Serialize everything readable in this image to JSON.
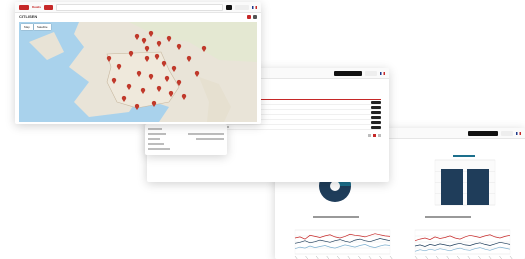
{
  "app": {
    "logo_text": "Dualis",
    "map_title": "CITLISEN",
    "map_tabs": [
      "Map",
      "Satellite"
    ]
  },
  "colors": {
    "accent": "#c62828",
    "dark": "#1f3d5a",
    "teal": "#1c6f8c"
  },
  "icons": [
    "logo-icon",
    "search-icon",
    "flag-icon",
    "map-marker-icon",
    "close-icon"
  ],
  "chart_data": [
    {
      "type": "bar",
      "categories": [
        "",
        ""
      ],
      "values": [
        80,
        80
      ],
      "title": "",
      "ylim": [
        0,
        100
      ]
    },
    {
      "type": "line",
      "x": [
        1,
        2,
        3,
        4,
        5,
        6,
        7,
        8,
        9,
        10,
        11,
        12,
        13,
        14,
        15,
        16,
        17,
        18,
        19,
        20
      ],
      "series": [
        {
          "values": [
            50,
            52,
            48,
            55,
            53,
            51,
            54,
            56,
            52,
            50,
            53,
            57,
            55,
            54,
            52,
            55,
            58,
            56,
            54,
            53
          ]
        },
        {
          "values": [
            40,
            42,
            45,
            41,
            43,
            46,
            44,
            42,
            45,
            47,
            44,
            42,
            46,
            48,
            45,
            43,
            46,
            49,
            47,
            45
          ]
        },
        {
          "values": [
            30,
            33,
            31,
            35,
            32,
            34,
            36,
            33,
            31,
            34,
            37,
            35,
            33,
            36,
            38,
            34,
            32,
            35,
            37,
            36
          ]
        }
      ],
      "title": ""
    },
    {
      "type": "line",
      "x": [
        1,
        2,
        3,
        4,
        5,
        6,
        7,
        8,
        9,
        10,
        11,
        12,
        13,
        14,
        15,
        16,
        17,
        18,
        19,
        20
      ],
      "series": [
        {
          "values": [
            45,
            48,
            50,
            47,
            52,
            49,
            51,
            54,
            50,
            48,
            52,
            55,
            53,
            51,
            54,
            56,
            52,
            50,
            53,
            55
          ]
        },
        {
          "values": [
            35,
            37,
            34,
            38,
            36,
            39,
            37,
            35,
            38,
            40,
            37,
            36,
            39,
            41,
            38,
            36,
            39,
            42,
            40,
            38
          ]
        },
        {
          "values": [
            25,
            28,
            26,
            29,
            27,
            30,
            28,
            26,
            29,
            31,
            28,
            27,
            30,
            32,
            29,
            27,
            30,
            33,
            31,
            29
          ]
        }
      ],
      "title": ""
    }
  ]
}
